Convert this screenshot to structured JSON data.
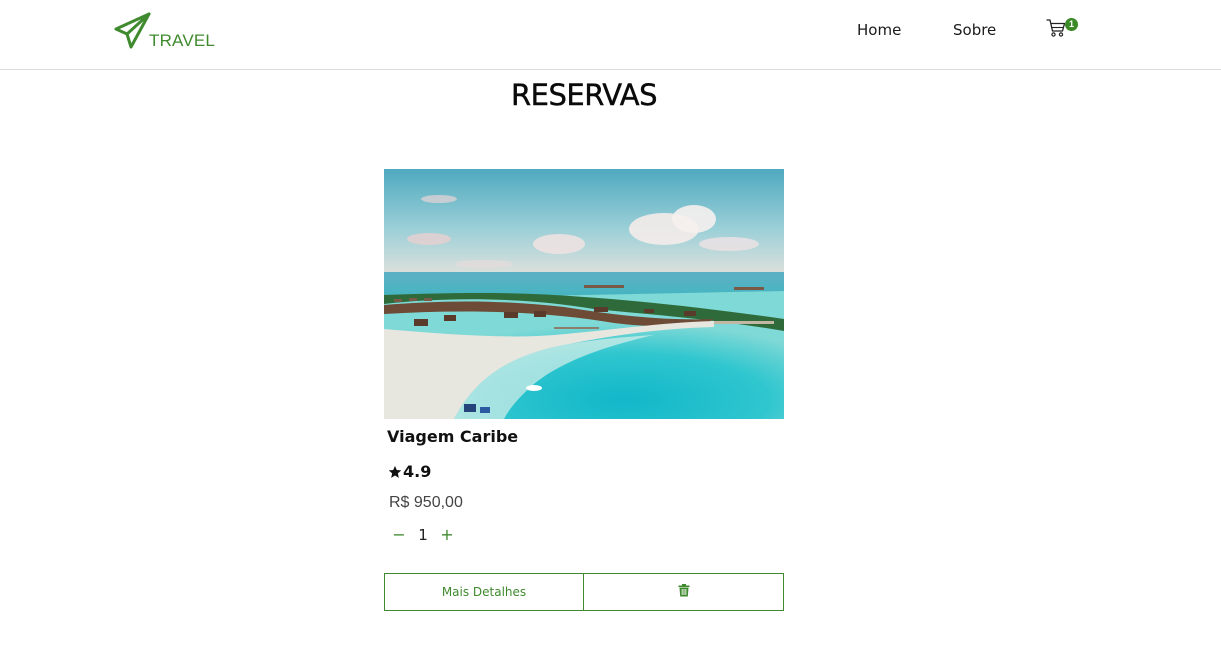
{
  "brand": {
    "name": "TRAVEL",
    "color": "#3f8a2e"
  },
  "nav": {
    "links": [
      {
        "label": "Home"
      },
      {
        "label": "Sobre"
      }
    ],
    "cart": {
      "icon": "cart-icon",
      "count": "1"
    }
  },
  "page": {
    "title": "RESERVAS"
  },
  "reservation": {
    "image_subject": "tropical-beach-resort",
    "title": "Viagem Caribe",
    "rating": "4.9",
    "rating_icon": "star-icon",
    "price": "R$ 950,00",
    "quantity": "1",
    "decrease_label": "−",
    "increase_label": "+",
    "details_label": "Mais Detalhes",
    "delete_icon": "trash-icon"
  },
  "colors": {
    "accent": "#3f8a2e",
    "badge": "#3b8a27",
    "divider": "#dcdcdc"
  }
}
